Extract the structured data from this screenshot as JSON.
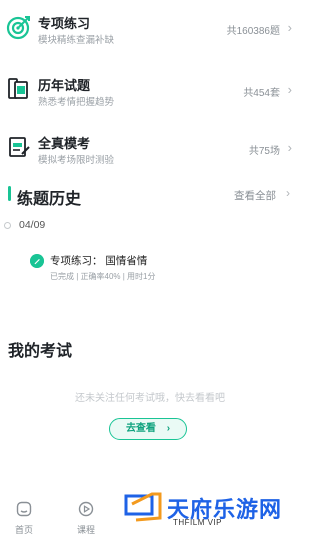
{
  "practice_items": [
    {
      "title": "专项练习",
      "subtitle": "模块精练查漏补缺",
      "count": "共160386题",
      "icon": "target-icon"
    },
    {
      "title": "历年试题",
      "subtitle": "熟悉考情把握趋势",
      "count": "共454套",
      "icon": "books-icon"
    },
    {
      "title": "全真模考",
      "subtitle": "模拟考场限时测验",
      "count": "共75场",
      "icon": "exam-paper-icon"
    }
  ],
  "history": {
    "title": "练题历史",
    "view_all": "查看全部",
    "date": "04/09",
    "entry_title": "专项练习：  国情省情",
    "entry_sub": "已完成 | 正确率40% | 用时1分"
  },
  "exam": {
    "title": "我的考试",
    "empty_text": "还未关注任何考试哦，快去看看吧",
    "button_label": "去查看"
  },
  "tabbar": {
    "home": "首页",
    "course": "课程"
  },
  "watermark": {
    "brand": "天府乐游网",
    "sub": "THFILM VIP"
  },
  "colors": {
    "accent": "#19c495",
    "brand_blue": "#1e62e6",
    "brand_orange": "#f39a1e"
  }
}
